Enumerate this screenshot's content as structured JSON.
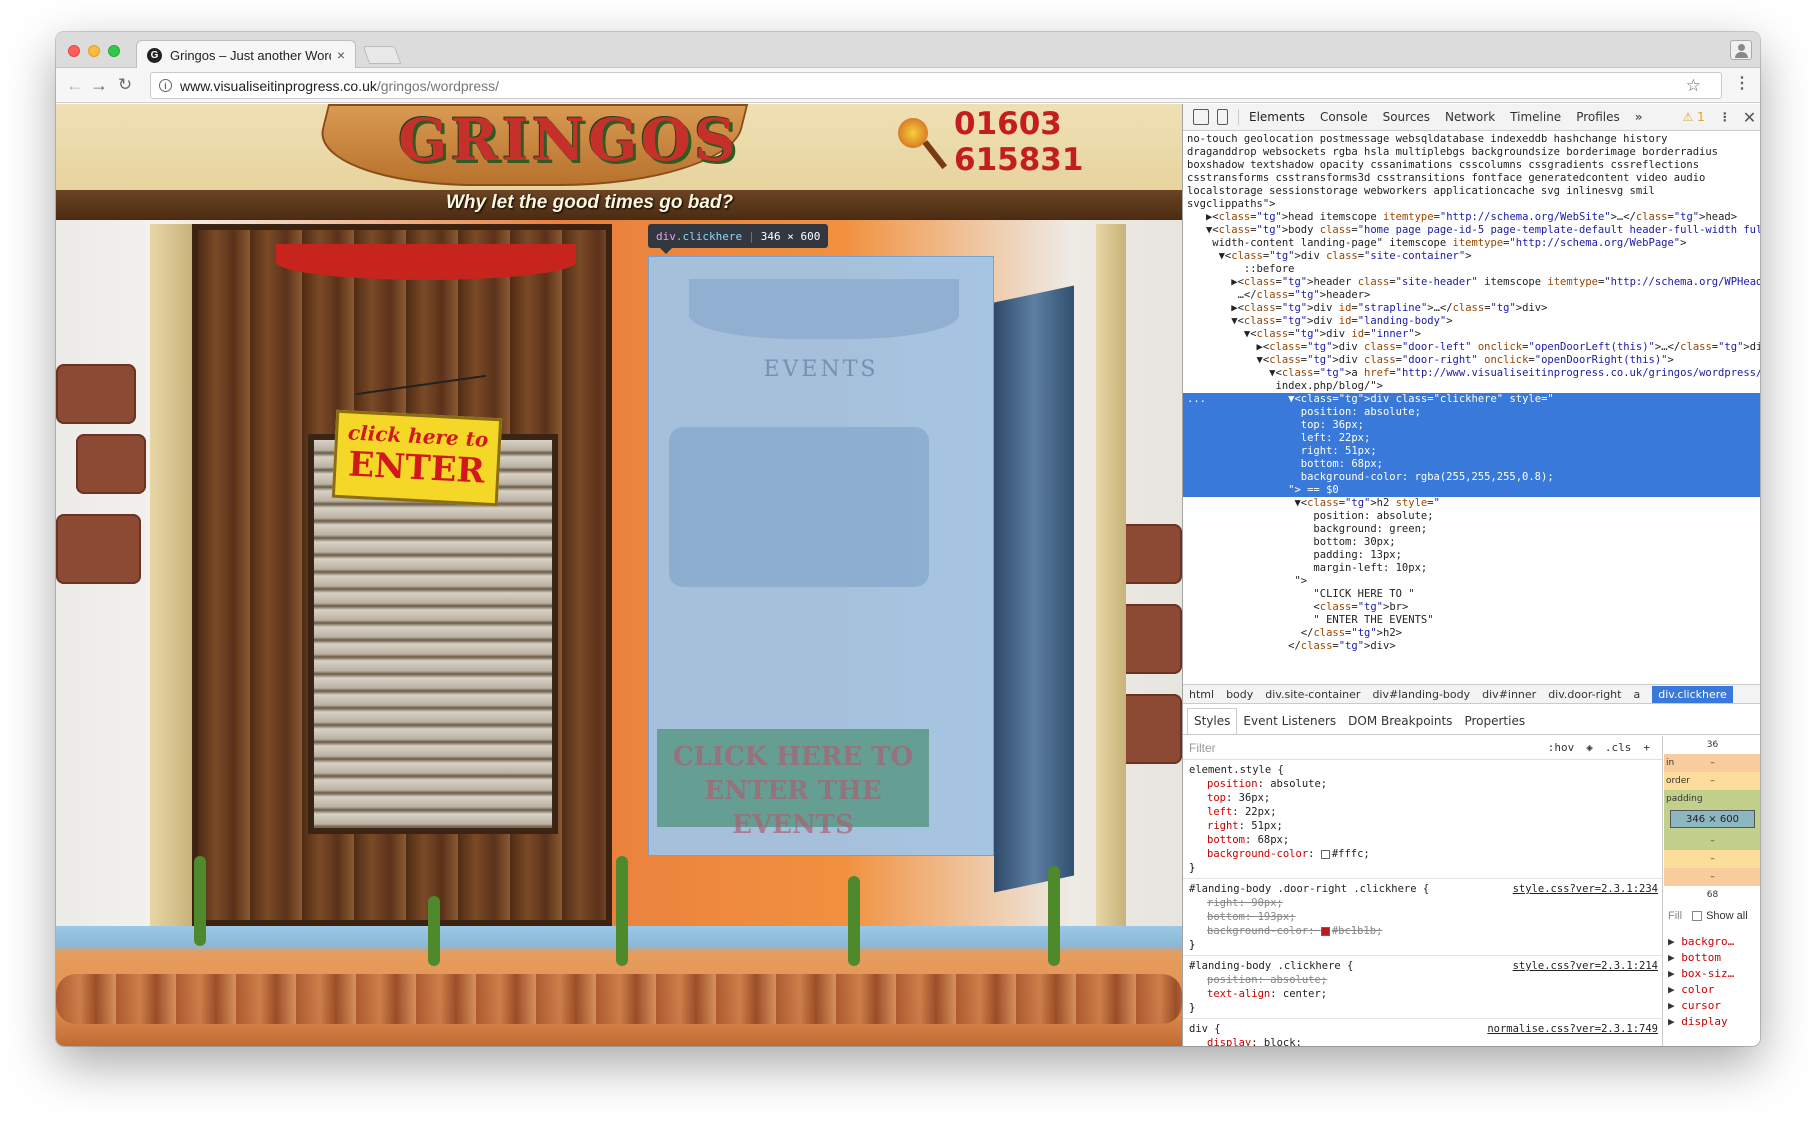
{
  "browser": {
    "tab_title": "Gringos – Just another WordP",
    "tab_favicon": "G",
    "url_host": "www.visualiseitinprogress.co.uk",
    "url_path": "/gringos/wordpress/"
  },
  "site": {
    "logo": "GRINGOS",
    "tagline": "Why let the good times go bad?",
    "phone_line1": "01603",
    "phone_line2": "615831",
    "enter_sign_line1": "click here to",
    "enter_sign_line2": "ENTER",
    "ghost_events": "EVENTS",
    "events_line1": "CLICK HERE TO",
    "events_line2": "ENTER THE EVENTS",
    "tooltip_selector": "div",
    "tooltip_class": ".clickhere",
    "tooltip_size": "346 × 600"
  },
  "devtools": {
    "tabs": [
      "Elements",
      "Console",
      "Sources",
      "Network",
      "Timeline",
      "Profiles"
    ],
    "more": "»",
    "warnings": "⚠ 1",
    "dom_lines": [
      {
        "text": "no-touch geolocation postmessage websqldatabase indexeddb hashchange history"
      },
      {
        "text": "draganddrop websockets rgba hsla multiplebgs backgroundsize borderimage borderradius"
      },
      {
        "text": "boxshadow textshadow opacity cssanimations csscolumns cssgradients cssreflections"
      },
      {
        "text": "csstransforms csstransforms3d csstransitions fontface generatedcontent video audio"
      },
      {
        "text": "localstorage sessionstorage webworkers applicationcache svg inlinesvg smil"
      },
      {
        "text": "svgclippaths\">"
      },
      {
        "text": "   ▶<head itemscope itemtype=\"http://schema.org/WebSite\">…</head>"
      },
      {
        "text": "   ▼<body class=\"home page page-id-5 page-template-default header-full-width full-"
      },
      {
        "text": "    width-content landing-page\" itemscope itemtype=\"http://schema.org/WebPage\">"
      },
      {
        "text": "     ▼<div class=\"site-container\">"
      },
      {
        "text": "         ::before"
      },
      {
        "text": "       ▶<header class=\"site-header\" itemscope itemtype=\"http://schema.org/WPHeader\">"
      },
      {
        "text": "        …</header>"
      },
      {
        "text": "       ▶<div id=\"strapline\">…</div>"
      },
      {
        "text": "       ▼<div id=\"landing-body\">"
      },
      {
        "text": "         ▼<div id=\"inner\">"
      },
      {
        "text": "           ▶<div class=\"door-left\" onclick=\"openDoorLeft(this)\">…</div>"
      },
      {
        "text": "           ▼<div class=\"door-right\" onclick=\"openDoorRight(this)\">"
      },
      {
        "text": "             ▼<a href=\"http://www.visualiseitinprogress.co.uk/gringos/wordpress/"
      },
      {
        "text": "              index.php/blog/\">"
      },
      {
        "text": "...             ▼<div class=\"clickhere\" style=\"",
        "sel": true
      },
      {
        "text": "                  position: absolute;",
        "sel": true
      },
      {
        "text": "                  top: 36px;",
        "sel": true
      },
      {
        "text": "                  left: 22px;",
        "sel": true
      },
      {
        "text": "                  right: 51px;",
        "sel": true
      },
      {
        "text": "                  bottom: 68px;",
        "sel": true
      },
      {
        "text": "                  background-color: rgba(255,255,255,0.8);",
        "sel": true
      },
      {
        "text": "                \"> == $0",
        "sel": true
      },
      {
        "text": "                 ▼<h2 style=\""
      },
      {
        "text": "                    position: absolute;"
      },
      {
        "text": "                    background: green;"
      },
      {
        "text": "                    bottom: 30px;"
      },
      {
        "text": "                    padding: 13px;"
      },
      {
        "text": "                    margin-left: 10px;"
      },
      {
        "text": "                 \">"
      },
      {
        "text": "                    \"CLICK HERE TO \""
      },
      {
        "text": "                    <br>"
      },
      {
        "text": "                    \" ENTER THE EVENTS\""
      },
      {
        "text": "                  </h2>"
      },
      {
        "text": "                </div>"
      }
    ],
    "breadcrumbs": [
      "html",
      "body",
      "div.site-container",
      "div#landing-body",
      "div#inner",
      "div.door-right",
      "a"
    ],
    "breadcrumb_active": "div.clickhere",
    "subtabs": [
      "Styles",
      "Event Listeners",
      "DOM Breakpoints",
      "Properties"
    ],
    "filter_placeholder": "Filter",
    "filter_hov": ":hov",
    "filter_cls": ".cls",
    "filter_add": "+",
    "rules": [
      {
        "selector": "element.style {",
        "source": "",
        "props": [
          {
            "name": "position",
            "value": "absolute;"
          },
          {
            "name": "top",
            "value": "36px;"
          },
          {
            "name": "left",
            "value": "22px;"
          },
          {
            "name": "right",
            "value": "51px;"
          },
          {
            "name": "bottom",
            "value": "68px;"
          },
          {
            "name": "background-color",
            "value": "#fffc;",
            "swatch": "#ffffff"
          }
        ]
      },
      {
        "selector": "#landing-body .door-right .clickhere {",
        "source": "style.css?ver=2.3.1:234",
        "props": [
          {
            "name": "right",
            "value": "90px;",
            "strike": true
          },
          {
            "name": "bottom",
            "value": "193px;",
            "strike": true
          },
          {
            "name": "background-color",
            "value": "#bc1b1b;",
            "strike": true,
            "swatch": "#bc1b1b"
          }
        ]
      },
      {
        "selector": "#landing-body .clickhere {",
        "source": "style.css?ver=2.3.1:214",
        "props": [
          {
            "name": "position",
            "value": "absolute;",
            "strike": true
          },
          {
            "name": "text-align",
            "value": "center;"
          }
        ]
      },
      {
        "selector": "div {",
        "source": "normalise.css?ver=2.3.1:749",
        "props": [
          {
            "name": "display",
            "value": "block;"
          }
        ]
      }
    ],
    "box_model": {
      "top_value": "36",
      "margin_label": "in",
      "margin_value": "–",
      "border_label": "order",
      "border_value": "–",
      "padding_label": "padding",
      "content_size": "346 × 600",
      "pad_bottom": "–",
      "border_bottom": "–",
      "margin_bottom": "–",
      "bottom_value": "68"
    },
    "fill_label": "Fill",
    "show_all": "Show all",
    "computed": [
      "backgro…",
      "bottom",
      "box-siz…",
      "color",
      "cursor",
      "display"
    ]
  }
}
